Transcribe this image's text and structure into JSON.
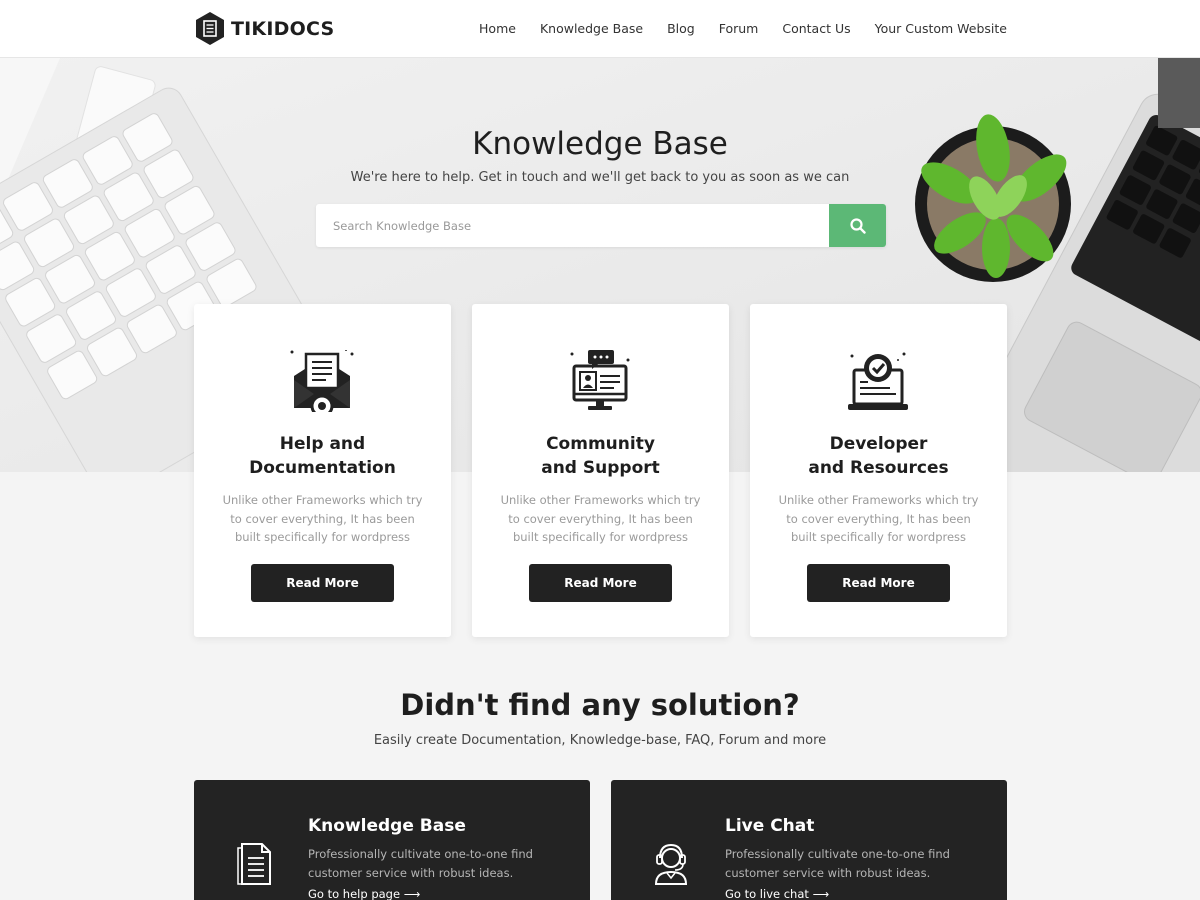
{
  "brand": {
    "name": "TIKIDOCS"
  },
  "nav": [
    "Home",
    "Knowledge Base",
    "Blog",
    "Forum",
    "Contact Us",
    "Your Custom Website"
  ],
  "hero": {
    "title": "Knowledge Base",
    "subtitle": "We're here to help. Get in touch and we'll get back to you as soon as we can",
    "search_placeholder": "Search Knowledge Base"
  },
  "cards": [
    {
      "title_line1": "Help and",
      "title_line2": "Documentation",
      "text": "Unlike other Frameworks which try to cover everything, It has been built specifically for wordpress",
      "button": "Read More",
      "icon": "envelope-document-gear-icon"
    },
    {
      "title_line1": "Community",
      "title_line2": "and Support",
      "text": "Unlike other Frameworks which try to cover everything, It has been built specifically for wordpress",
      "button": "Read More",
      "icon": "monitor-chat-profile-icon"
    },
    {
      "title_line1": "Developer",
      "title_line2": "and Resources",
      "text": "Unlike other Frameworks which try to cover everything, It has been built specifically for wordpress",
      "button": "Read More",
      "icon": "laptop-checkmark-icon"
    }
  ],
  "section2": {
    "title": "Didn't find any solution?",
    "subtitle": "Easily create Documentation, Knowledge-base, FAQ, Forum and more"
  },
  "features": [
    {
      "title": "Knowledge Base",
      "text": "Professionally cultivate one-to-one find customer service with robust ideas.",
      "link": "Go to help page",
      "icon": "document-icon"
    },
    {
      "title": "Live Chat",
      "text": "Professionally cultivate one-to-one find customer service with robust ideas.",
      "link": "Go to live chat",
      "icon": "headset-agent-icon"
    }
  ],
  "colors": {
    "accent_green": "#5cb876",
    "dark": "#232323",
    "button": "#222222"
  }
}
